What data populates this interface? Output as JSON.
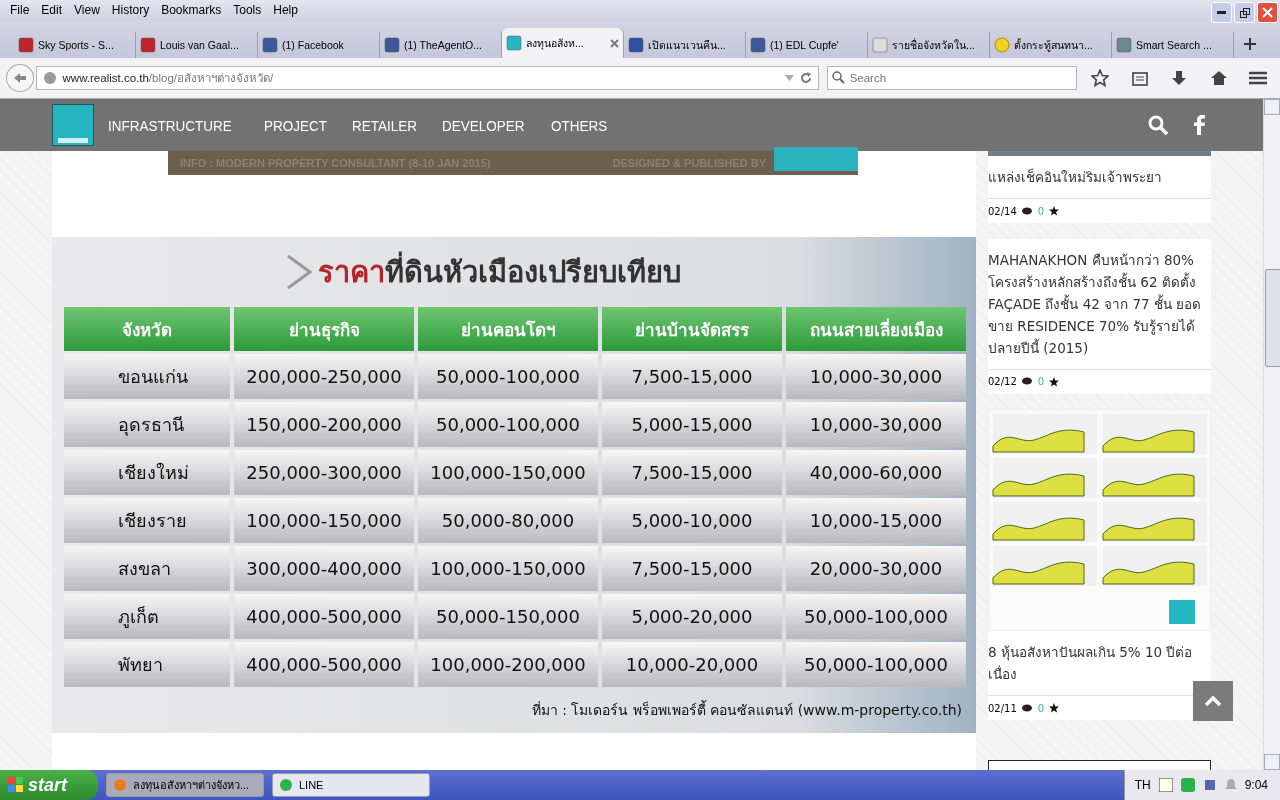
{
  "menu": [
    "File",
    "Edit",
    "View",
    "History",
    "Bookmarks",
    "Tools",
    "Help"
  ],
  "tabs": [
    {
      "label": "Sky Sports - S...",
      "kind": "sport",
      "selected": false
    },
    {
      "label": "Louis van Gaal...",
      "kind": "sport",
      "selected": false
    },
    {
      "label": "(1) Facebook",
      "kind": "social",
      "selected": false
    },
    {
      "label": "(1) TheAgentO...",
      "kind": "social",
      "selected": false
    },
    {
      "label": "ลงทุนอสังห...",
      "kind": "site",
      "selected": true
    },
    {
      "label": "เปิดแนวเวนคืน...",
      "kind": "news",
      "selected": false
    },
    {
      "label": "(1) EDL Cupfe'",
      "kind": "social",
      "selected": false
    },
    {
      "label": "รายชื่อจังหวัดใน...",
      "kind": "wiki",
      "selected": false
    },
    {
      "label": "ตั้งกระทู้สนทนา...",
      "kind": "smile",
      "selected": false
    },
    {
      "label": "Smart Search ...",
      "kind": "search",
      "selected": false
    }
  ],
  "address": {
    "host": "www.realist.co.th",
    "path": "/blog/อสังหาฯต่างจังหวัด/"
  },
  "search": {
    "placeholder": "Search"
  },
  "site_nav": [
    "INFRASTRUCTURE",
    "PROJECT",
    "RETAILER",
    "DEVELOPER",
    "OTHERS"
  ],
  "banner": {
    "left": "INFO :  MODERN PROPERTY CONSULTANT (8-10 JAN 2015)",
    "right": "DESIGNED & PUBLISHED BY"
  },
  "price_table": {
    "title_highlight": "ราคา",
    "title_rest": "ที่ดินหัวเมืองเปรียบเทียบ",
    "columns": [
      "จังหวัด",
      "ย่านธุรกิจ",
      "ย่านคอนโดฯ",
      "ย่านบ้านจัดสรร",
      "ถนนสายเลี่ยงเมือง"
    ],
    "rows": [
      [
        "ขอนแก่น",
        "200,000-250,000",
        "50,000-100,000",
        "7,500-15,000",
        "10,000-30,000"
      ],
      [
        "อุดรธานี",
        "150,000-200,000",
        "50,000-100,000",
        "5,000-15,000",
        "10,000-30,000"
      ],
      [
        "เชียงใหม่",
        "250,000-300,000",
        "100,000-150,000",
        "7,500-15,000",
        "40,000-60,000"
      ],
      [
        "เชียงราย",
        "100,000-150,000",
        "50,000-80,000",
        "5,000-10,000",
        "10,000-15,000"
      ],
      [
        "สงขลา",
        "300,000-400,000",
        "100,000-150,000",
        "7,500-15,000",
        "20,000-30,000"
      ],
      [
        "ภูเก็ต",
        "400,000-500,000",
        "50,000-150,000",
        "5,000-20,000",
        "50,000-100,000"
      ],
      [
        "พัทยา",
        "400,000-500,000",
        "100,000-200,000",
        "10,000-20,000",
        "50,000-100,000"
      ]
    ],
    "source": "ที่มา : โมเดอร์น พร็อพเพอร์ตี้ คอนซัลแตนท์ (www.m-property.co.th)"
  },
  "sidebar_posts": [
    {
      "title": "แหล่งเช็คอินใหม่ริมเจ้าพระยา",
      "date": "02/14",
      "comments": "0",
      "kind": "top"
    },
    {
      "title": "MAHANAKHON คืบหน้ากว่า 80% โครงสร้างหลักสร้างถึงชั้น 62 ติดตั้ง FAÇADE ถึงชั้น 42 จาก 77 ชั้น ยอดขาย RESIDENCE 70% รับรู้รายได้ปลายปีนี้ (2015)",
      "date": "02/12",
      "comments": "0",
      "kind": "text"
    },
    {
      "title": "8 หุ้นอสังหาปันผลเกิน 5% 10 ปีต่อเนื่อง",
      "date": "02/11",
      "comments": "0",
      "kind": "charts"
    }
  ],
  "taskbar": {
    "start": "start",
    "tasks": [
      {
        "label": "ลงทุนอสังหาฯต่างจังหว...",
        "selected": true
      },
      {
        "label": "LINE",
        "selected": false
      }
    ],
    "language": "TH",
    "clock": "9:04"
  }
}
